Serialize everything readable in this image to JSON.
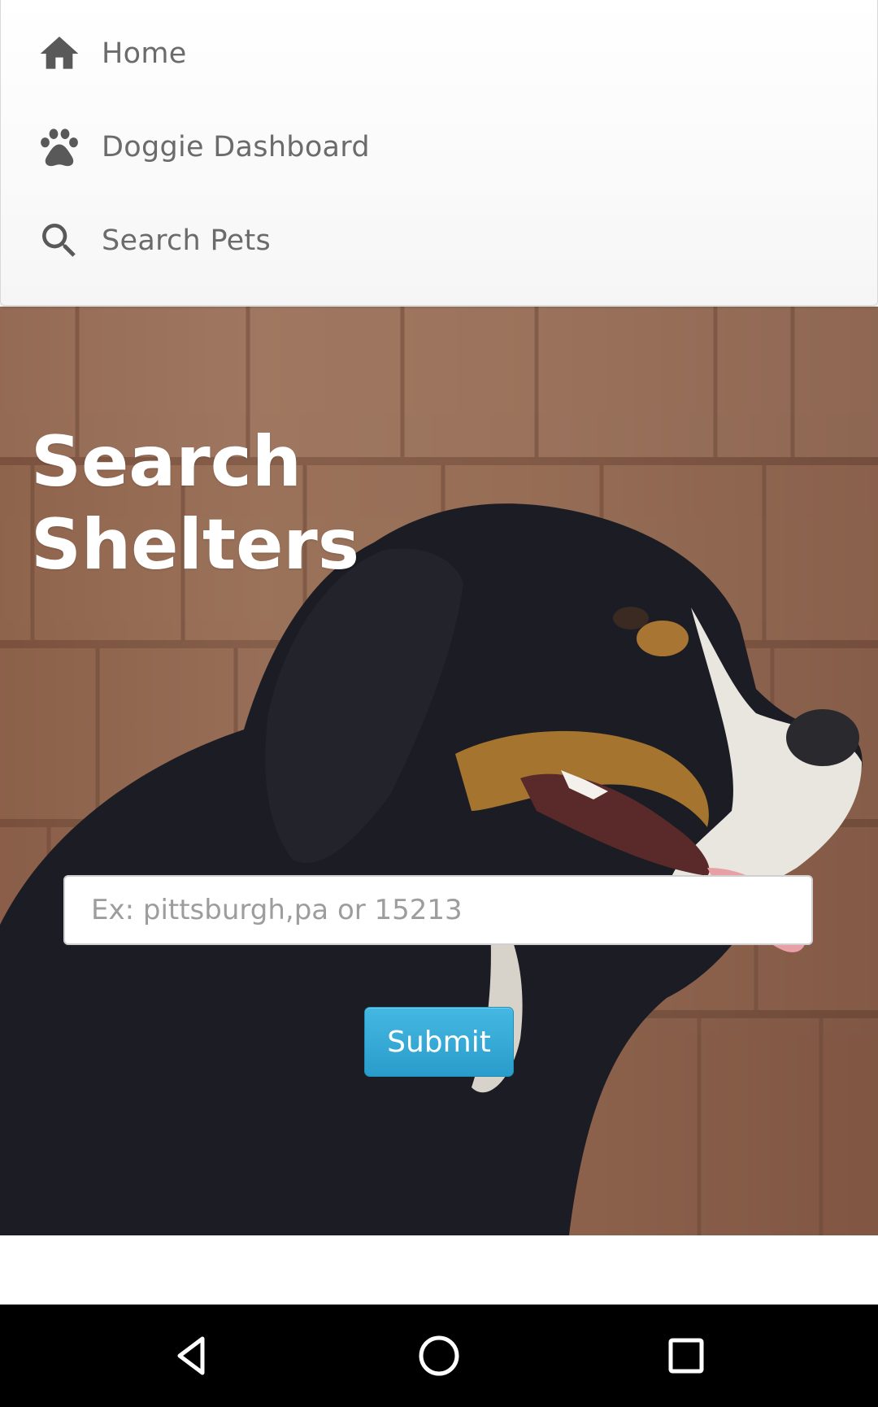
{
  "nav": {
    "items": [
      {
        "label": "Home",
        "icon": "home-icon"
      },
      {
        "label": "Doggie Dashboard",
        "icon": "paw-icon"
      },
      {
        "label": "Search Pets",
        "icon": "search-icon"
      }
    ]
  },
  "hero": {
    "title": "Search Shelters",
    "search": {
      "placeholder": "Ex: pittsburgh,pa or 15213",
      "value": ""
    },
    "submit_label": "Submit"
  },
  "system_nav": {
    "buttons": [
      "back-icon",
      "home-circle-icon",
      "recents-icon"
    ]
  },
  "colors": {
    "nav_text": "#6b6b6b",
    "nav_icon": "#595959",
    "submit_button": "#33a8d6",
    "title_text": "#ffffff"
  }
}
